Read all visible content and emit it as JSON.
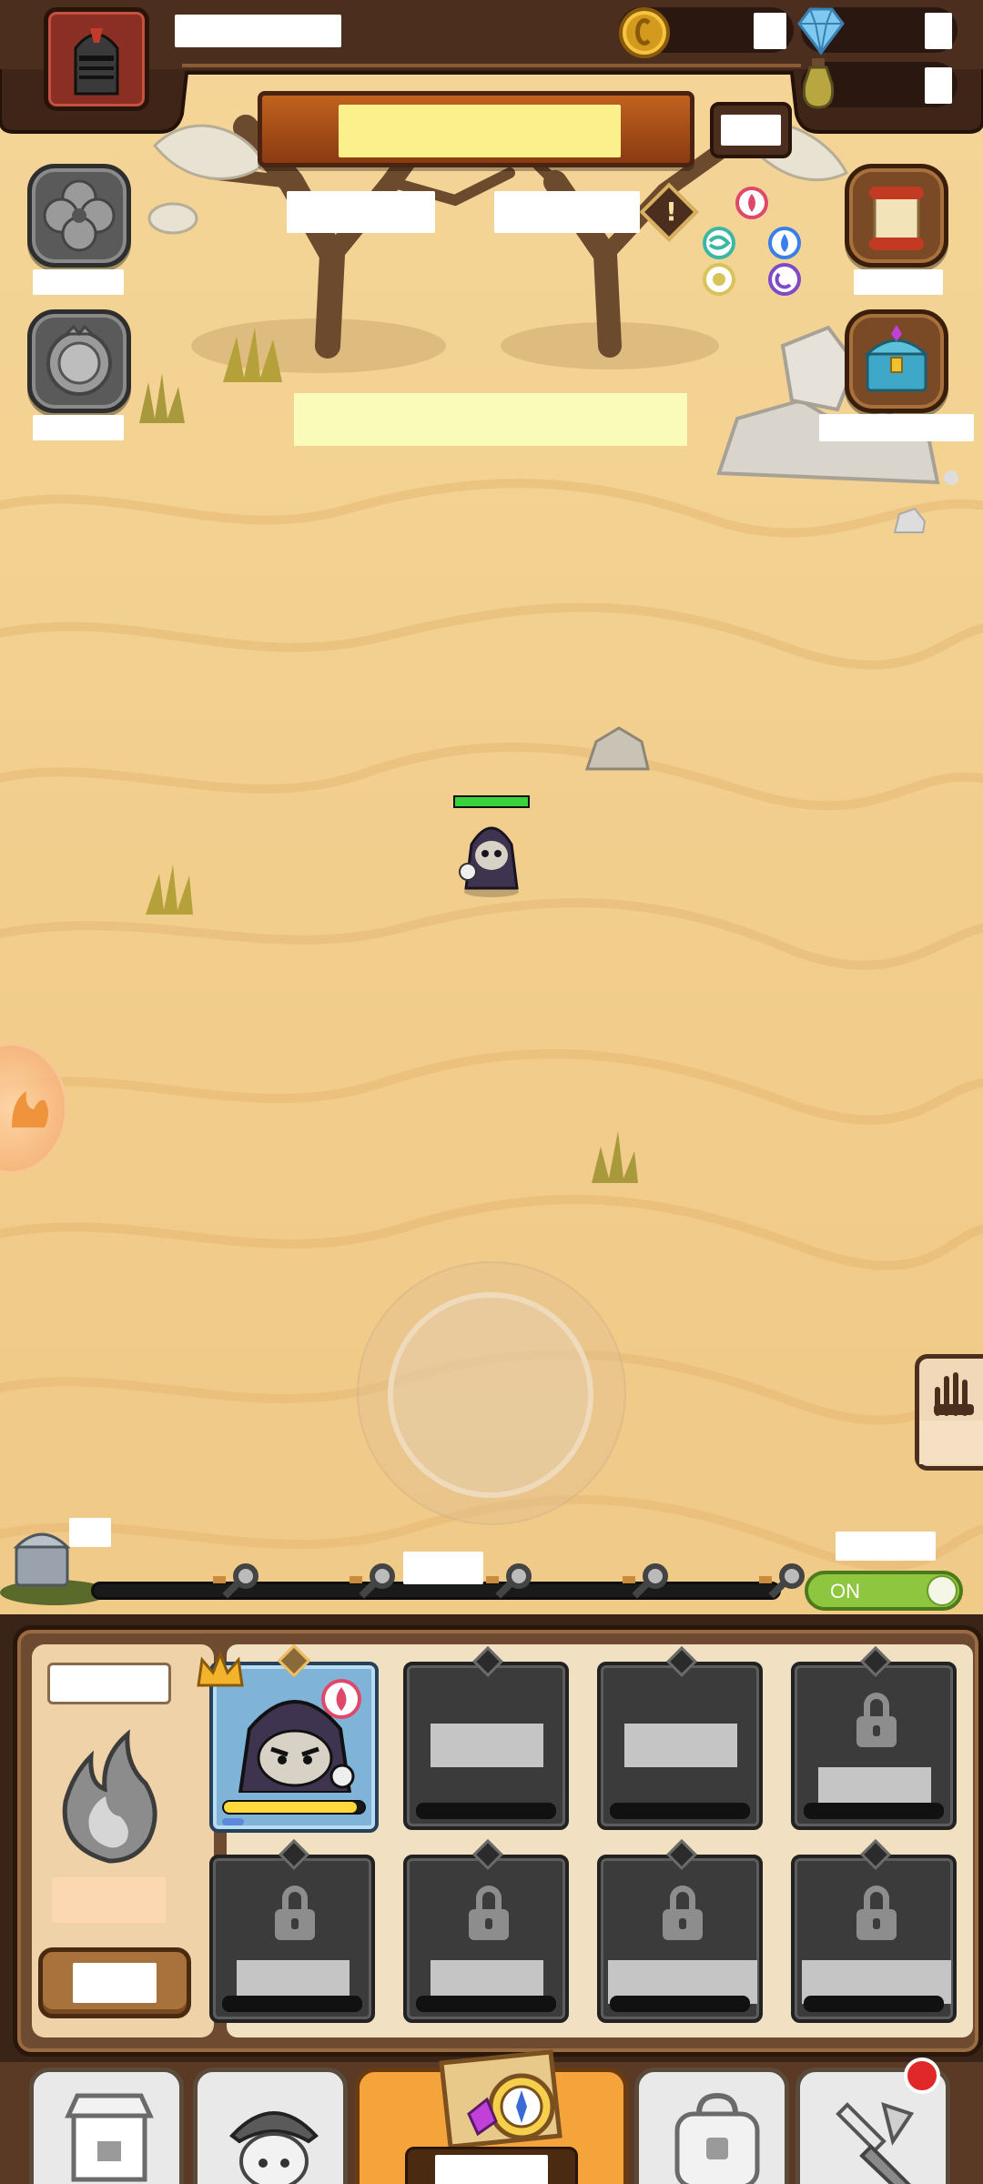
{
  "auto_toggle": {
    "label": "ON"
  },
  "colors": {
    "sand": "#f1cd8c",
    "wood_frame": "#4e3220",
    "toggle_green": "#8ec63f",
    "hp_green": "#39d13c",
    "nav_active": "#f4a43a",
    "exp_bar": "#ffd93b"
  },
  "icons": {
    "profile": "knight-helmet-icon",
    "gold": "gold-coin-icon",
    "gem": "gem-icon",
    "potion": "potion-icon",
    "alert": "exclamation-icon",
    "quest": "scroll-icon",
    "treasure": "treasure-chest-icon",
    "flame": "silver-flame-icon",
    "shop": "shop-icon",
    "hero": "hero-icon",
    "map": "map-compass-icon",
    "bag": "backpack-icon",
    "forge": "hammer-icon"
  },
  "hero_slot": {
    "exp_ratio": 0.95,
    "hp_ratio": 1.0
  },
  "stage_progress": {
    "ratio": 0.0
  }
}
